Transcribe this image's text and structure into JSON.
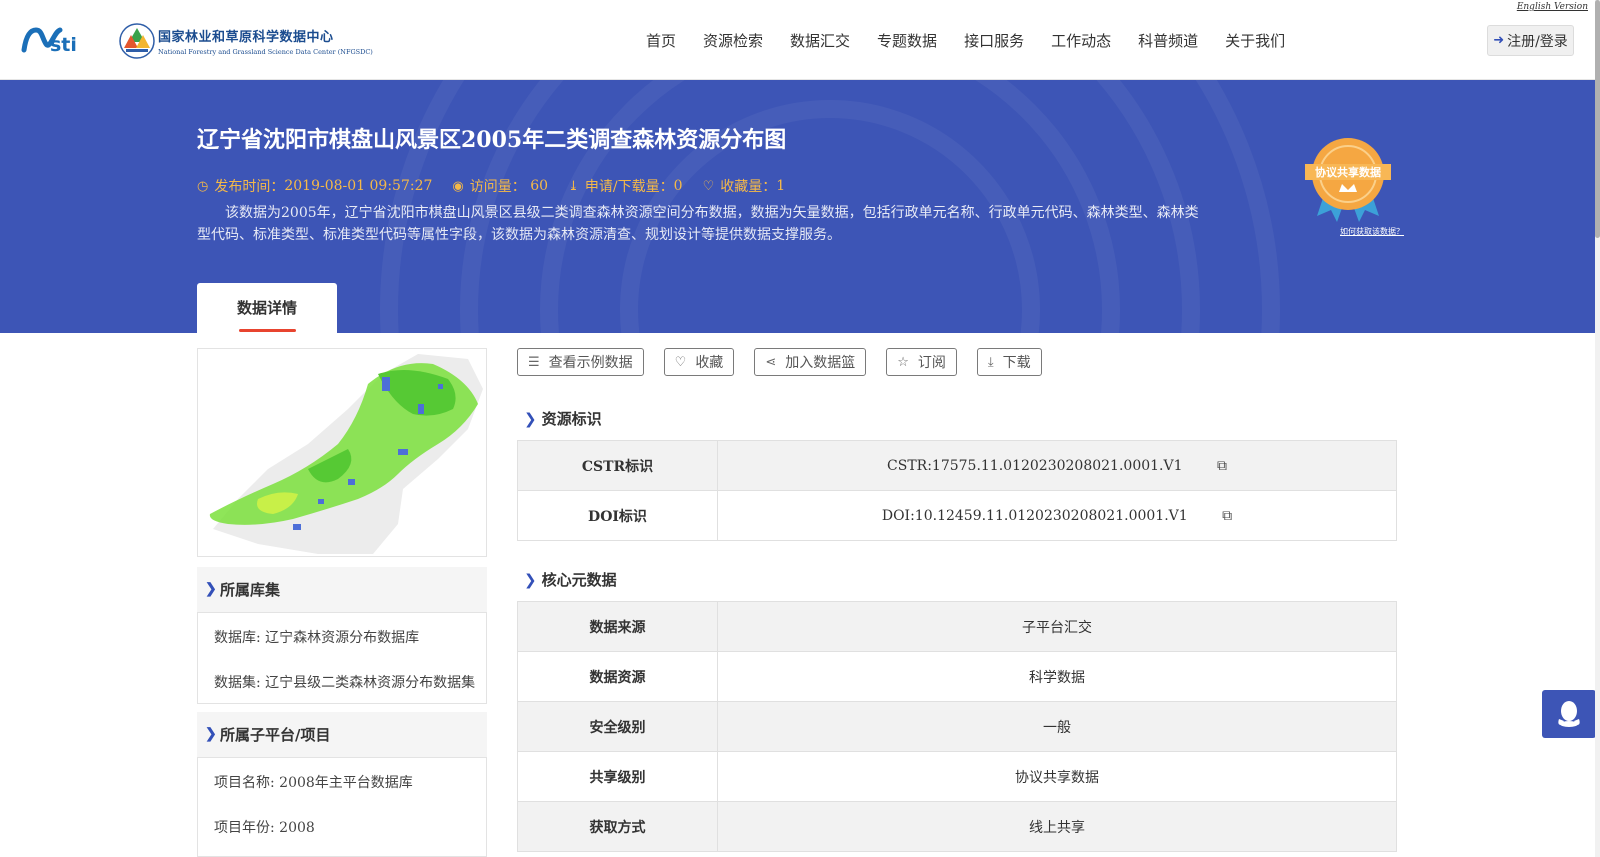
{
  "header": {
    "english_link": "English Version",
    "logo_cn": "国家林业和草原科学数据中心",
    "logo_en": "National Forestry and Grassland Science Data Center (NFGSDC)",
    "nav": [
      "首页",
      "资源检索",
      "数据汇交",
      "专题数据",
      "接口服务",
      "工作动态",
      "科普频道",
      "关于我们"
    ],
    "login_label": "注册/登录",
    "login_icon": "sign-in-icon"
  },
  "banner": {
    "title": "辽宁省沈阳市棋盘山风景区2005年二类调查森林资源分布图",
    "publish_label": "发布时间：",
    "publish_time": "2019-08-01 09:57:27",
    "visits_label": "访问量：",
    "visits": "60",
    "downloads_label": "申请/下载量：",
    "downloads": "0",
    "favorites_label": "收藏量：",
    "favorites": "1",
    "description": "该数据为2005年，辽宁省沈阳市棋盘山风景区县级二类调查森林资源空间分布数据，数据为矢量数据，包括行政单元名称、行政单元代码、森林类型、森林类型代码、标准类型、标准类型代码等属性字段，该数据为森林资源清查、规划设计等提供数据支撑服务。",
    "badge_text": "协议共享数据",
    "badge_link": "如何获取该数据？",
    "tab_label": "数据详情",
    "accent_color": "#3d55b6"
  },
  "left": {
    "library_title": "所属库集",
    "database": "数据库: 辽宁森林资源分布数据库",
    "dataset": "数据集: 辽宁县级二类森林资源分布数据集",
    "platform_title": "所属子平台/项目",
    "project_name": "项目名称: 2008年主平台数据库",
    "project_year": "项目年份: 2008"
  },
  "actions": [
    {
      "label": "查看示例数据",
      "icon": "database-icon"
    },
    {
      "label": "收藏",
      "icon": "heart-icon"
    },
    {
      "label": "加入数据篮",
      "icon": "share-icon"
    },
    {
      "label": "订阅",
      "icon": "star-icon"
    },
    {
      "label": "下载",
      "icon": "download-icon"
    }
  ],
  "resource_id": {
    "title": "资源标识",
    "rows": [
      {
        "key": "CSTR标识",
        "value": "CSTR:17575.11.0120230208021.0001.V1"
      },
      {
        "key": "DOI标识",
        "value": "DOI:10.12459.11.0120230208021.0001.V1"
      }
    ]
  },
  "core_meta": {
    "title": "核心元数据",
    "rows": [
      {
        "key": "数据来源",
        "value": "子平台汇交"
      },
      {
        "key": "数据资源",
        "value": "科学数据"
      },
      {
        "key": "安全级别",
        "value": "一般"
      },
      {
        "key": "共享级别",
        "value": "协议共享数据"
      },
      {
        "key": "获取方式",
        "value": "线上共享"
      }
    ]
  }
}
